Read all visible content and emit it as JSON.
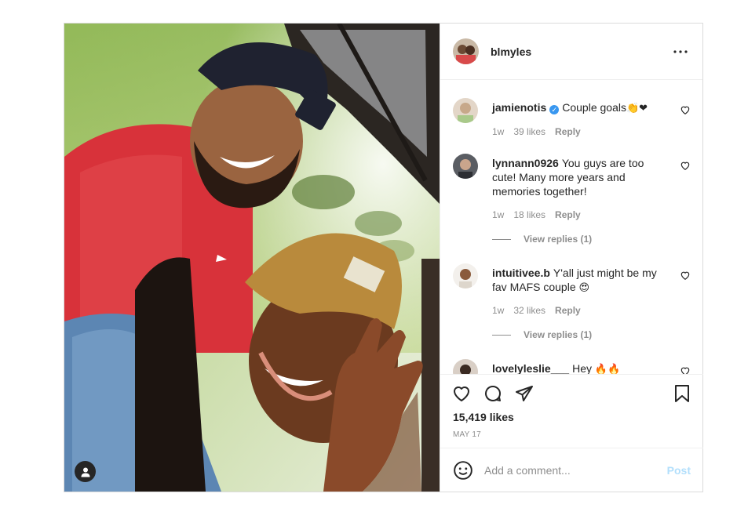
{
  "post": {
    "author": "blmyles",
    "more_icon": "more-horizontal-icon",
    "photo_user_tag_icon": "person-icon"
  },
  "comments": [
    {
      "user": "jamienotis",
      "verified": true,
      "text": "Couple goals",
      "emoji": "👏❤",
      "age": "1w",
      "likes": "39 likes",
      "reply": "Reply",
      "avatar_color": "#c7a88a"
    },
    {
      "user": "lynnann0926",
      "verified": false,
      "text": "You guys are too cute! Many more years and memories together!",
      "emoji": "",
      "age": "1w",
      "likes": "18 likes",
      "reply": "Reply",
      "view_replies": "View replies (1)",
      "avatar_color": "#7d7f86"
    },
    {
      "user": "intuitivee.b",
      "verified": false,
      "text": "Y'all just might be my fav MAFS couple",
      "emoji": "😍",
      "age": "1w",
      "likes": "32 likes",
      "reply": "Reply",
      "view_replies": "View replies (1)",
      "avatar_color": "#e6e2dc"
    },
    {
      "user": "lovelyleslie___",
      "verified": false,
      "text": "Hey",
      "emoji": "🔥🔥",
      "avatar_color": "#3a2a22"
    }
  ],
  "actions": {
    "like_icon": "heart-icon",
    "comment_icon": "comment-bubble-icon",
    "share_icon": "paper-plane-icon",
    "save_icon": "bookmark-icon",
    "likes": "15,419 likes",
    "date": "MAY 17"
  },
  "composer": {
    "emoji_icon": "smiley-icon",
    "placeholder": "Add a comment...",
    "post_label": "Post"
  },
  "colors": {
    "verified_blue": "#3897f0",
    "post_button_disabled": "#b2dffc",
    "muted_text": "#8e8e8e",
    "border": "#dbdbdb"
  }
}
